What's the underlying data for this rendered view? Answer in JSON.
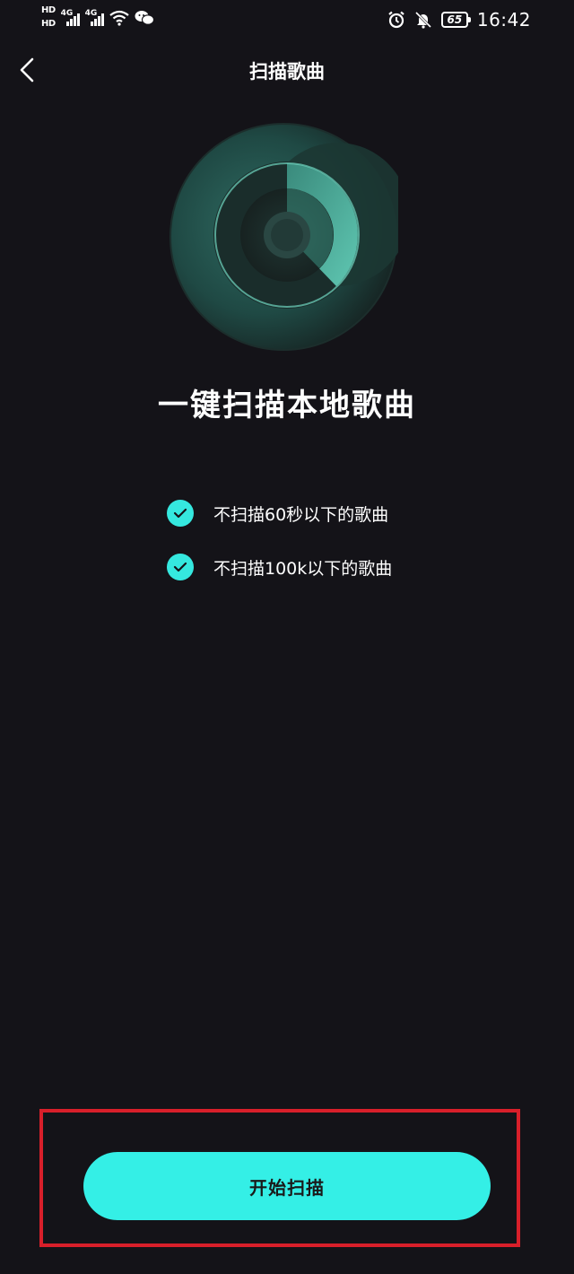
{
  "status_bar": {
    "hd1": "HD",
    "hd2": "HD",
    "net1": "4G",
    "net2": "4G",
    "battery": "65",
    "time": "16:42"
  },
  "nav": {
    "title": "扫描歌曲"
  },
  "main": {
    "headline": "一键扫描本地歌曲",
    "conditions": [
      "不扫描60秒以下的歌曲",
      "不扫描100k以下的歌曲"
    ]
  },
  "actions": {
    "start_label": "开始扫描"
  },
  "colors": {
    "background": "#141318",
    "accent": "#34efe6",
    "highlight": "#d81f2a"
  }
}
